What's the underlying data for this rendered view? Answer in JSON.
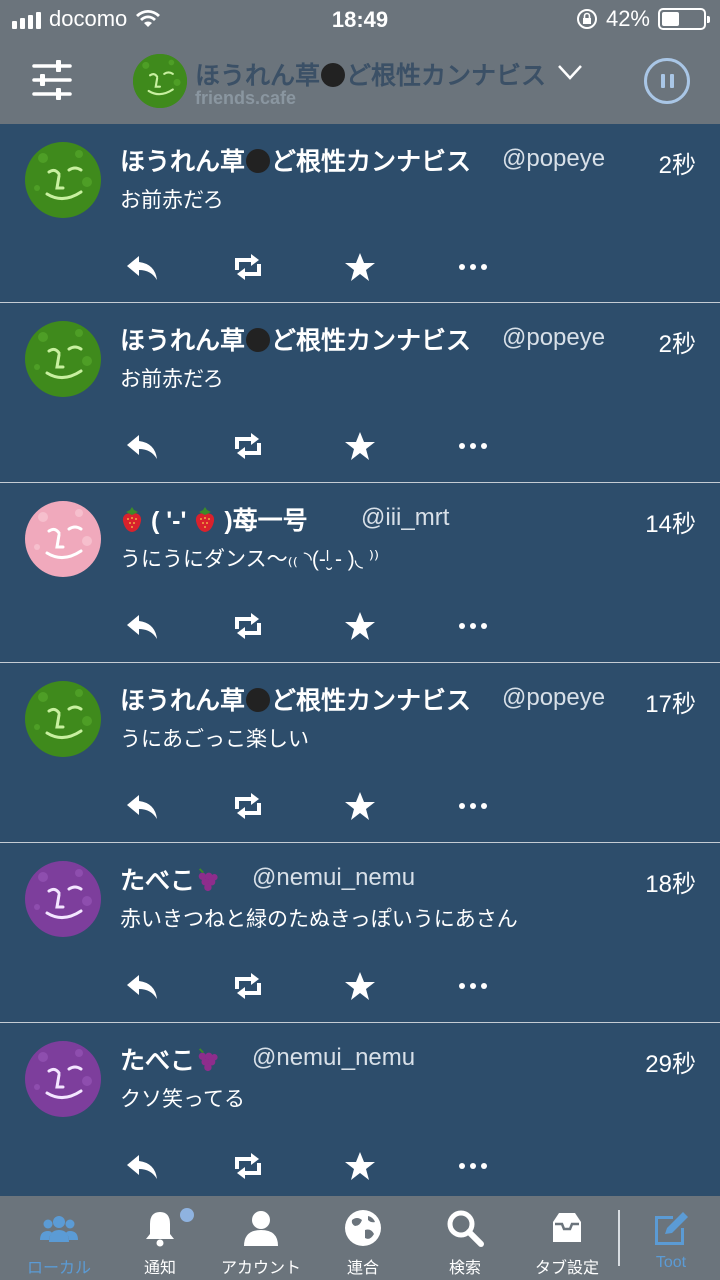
{
  "status_bar": {
    "carrier": "docomo",
    "time": "18:49",
    "battery": "42%",
    "battery_level": 0.42
  },
  "header": {
    "account_name": "ほうれん草",
    "account_name_suffix": "ど根性カンナビス",
    "instance": "friends.cafe"
  },
  "colors": {
    "accent": "#5b9bd5",
    "background": "#2d4d6b",
    "bar": "#6b747c",
    "green_avatar": "#3f8a1c",
    "pink_avatar": "#f0a9bc",
    "purple_avatar": "#7d3e9c"
  },
  "posts": [
    {
      "name": "ほうれん草",
      "name_suffix": "ど根性カンナビス",
      "handle": "@popeye",
      "time": "2秒",
      "text": "お前赤だろ",
      "avatar": "green"
    },
    {
      "name": "ほうれん草",
      "name_suffix": "ど根性カンナビス",
      "handle": "@popeye",
      "time": "2秒",
      "text": "お前赤だろ",
      "avatar": "green"
    },
    {
      "name": "( '-' ",
      "name_suffix": " )苺一号",
      "handle": "@iii_mrt",
      "time": "14秒",
      "text": "うにうにダンス〜₍₍ ◝(-ˡ̮ - )◟ ⁾⁾",
      "avatar": "pink"
    },
    {
      "name": "ほうれん草",
      "name_suffix": "ど根性カンナビス",
      "handle": "@popeye",
      "time": "17秒",
      "text": "うにあごっこ楽しい",
      "avatar": "green"
    },
    {
      "name": "たべこ",
      "name_suffix": "",
      "handle": "@nemui_nemu",
      "time": "18秒",
      "text": "赤いきつねと緑のたぬきっぽいうにあさん",
      "avatar": "purple"
    },
    {
      "name": "たべこ",
      "name_suffix": "",
      "handle": "@nemui_nemu",
      "time": "29秒",
      "text": "クソ笑ってる",
      "avatar": "purple"
    }
  ],
  "tabs": [
    {
      "label": "ローカル",
      "icon": "people-icon",
      "active": true
    },
    {
      "label": "通知",
      "icon": "bell-icon",
      "active": false
    },
    {
      "label": "アカウント",
      "icon": "person-icon",
      "active": false
    },
    {
      "label": "連合",
      "icon": "globe-icon",
      "active": false
    },
    {
      "label": "検索",
      "icon": "search-icon",
      "active": false
    },
    {
      "label": "タブ設定",
      "icon": "tray-icon",
      "active": false
    },
    {
      "label": "Toot",
      "icon": "compose-icon",
      "active": true
    }
  ]
}
